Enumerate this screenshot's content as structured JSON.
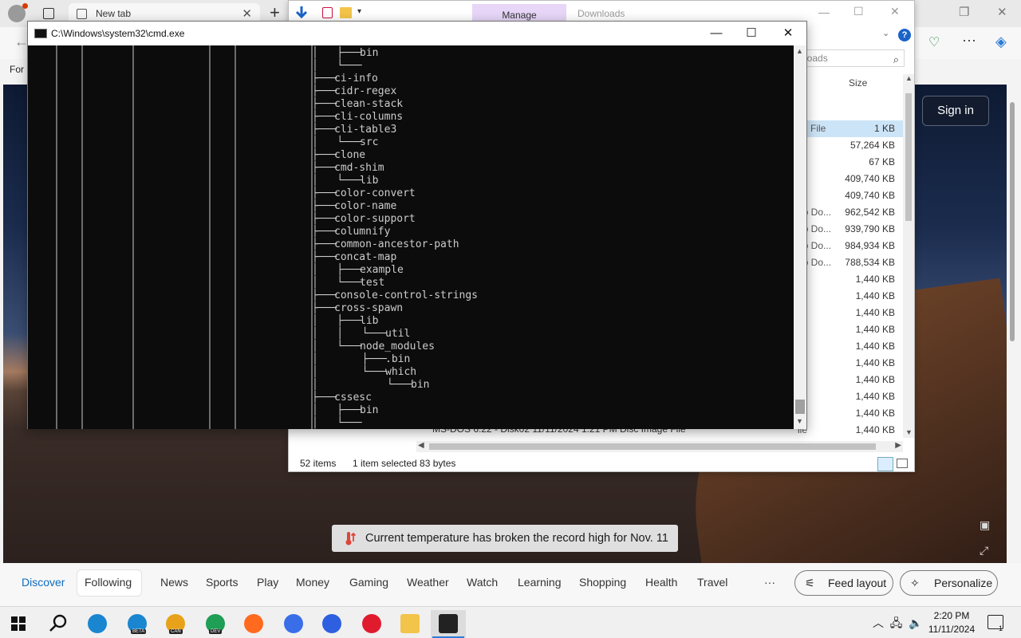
{
  "edge": {
    "tab_title": "New tab",
    "favorites_text": "For",
    "signin_label": "Sign in",
    "temperature_banner": "Current temperature has broken the record high for Nov. 11",
    "feed_tabs": [
      "Discover",
      "Following",
      "News",
      "Sports",
      "Play",
      "Money",
      "Gaming",
      "Weather",
      "Watch",
      "Learning",
      "Shopping",
      "Health",
      "Travel"
    ],
    "more_label": "···",
    "feed_layout_label": "Feed layout",
    "personalize_label": "Personalize"
  },
  "explorer": {
    "manage_label": "Manage",
    "title": "Downloads",
    "search_placeholder": "loads",
    "column_size": "Size",
    "rows": [
      {
        "type": "ch File",
        "size": "1 KB",
        "selected": true
      },
      {
        "type": "",
        "size": "57,264 KB"
      },
      {
        "type": "",
        "size": "67 KB"
      },
      {
        "type": "",
        "size": "409,740 KB"
      },
      {
        "type": "",
        "size": "409,740 KB"
      },
      {
        "type": "eb Do...",
        "size": "962,542 KB"
      },
      {
        "type": "eb Do...",
        "size": "939,790 KB"
      },
      {
        "type": "eb Do...",
        "size": "984,934 KB"
      },
      {
        "type": "eb Do...",
        "size": "788,534 KB"
      },
      {
        "type": "ile",
        "size": "1,440 KB"
      },
      {
        "type": "ile",
        "size": "1,440 KB"
      },
      {
        "type": "ile",
        "size": "1,440 KB"
      },
      {
        "type": "ile",
        "size": "1,440 KB"
      },
      {
        "type": "ile",
        "size": "1,440 KB"
      },
      {
        "type": "ile",
        "size": "1,440 KB"
      },
      {
        "type": "ile",
        "size": "1,440 KB"
      },
      {
        "type": "ile",
        "size": "1,440 KB"
      },
      {
        "type": "ile",
        "size": "1,440 KB"
      },
      {
        "type": "ile",
        "size": "1,440 KB"
      }
    ],
    "hidden_row_text": "MS-DOS 6.22 - Disk02          11/11/2024 1:21 PM          Disc Image File",
    "status_items": "52 items",
    "status_selected": "1 item selected  83 bytes"
  },
  "cmd": {
    "title": "C:\\Windows\\system32\\cmd.exe",
    "tree": [
      {
        "depth": 1,
        "connector": "│   ├───",
        "name": "bin"
      },
      {
        "depth": 1,
        "connector": "│   └───",
        "name": ""
      },
      {
        "depth": 0,
        "connector": "├───",
        "name": "ci-info"
      },
      {
        "depth": 0,
        "connector": "├───",
        "name": "cidr-regex"
      },
      {
        "depth": 0,
        "connector": "├───",
        "name": "clean-stack"
      },
      {
        "depth": 0,
        "connector": "├───",
        "name": "cli-columns"
      },
      {
        "depth": 0,
        "connector": "├───",
        "name": "cli-table3"
      },
      {
        "depth": 1,
        "connector": "│   └───",
        "name": "src"
      },
      {
        "depth": 0,
        "connector": "├───",
        "name": "clone"
      },
      {
        "depth": 0,
        "connector": "├───",
        "name": "cmd-shim"
      },
      {
        "depth": 1,
        "connector": "│   └───",
        "name": "lib"
      },
      {
        "depth": 0,
        "connector": "├───",
        "name": "color-convert"
      },
      {
        "depth": 0,
        "connector": "├───",
        "name": "color-name"
      },
      {
        "depth": 0,
        "connector": "├───",
        "name": "color-support"
      },
      {
        "depth": 0,
        "connector": "├───",
        "name": "columnify"
      },
      {
        "depth": 0,
        "connector": "├───",
        "name": "common-ancestor-path"
      },
      {
        "depth": 0,
        "connector": "├───",
        "name": "concat-map"
      },
      {
        "depth": 1,
        "connector": "│   ├───",
        "name": "example"
      },
      {
        "depth": 1,
        "connector": "│   └───",
        "name": "test"
      },
      {
        "depth": 0,
        "connector": "├───",
        "name": "console-control-strings"
      },
      {
        "depth": 0,
        "connector": "├───",
        "name": "cross-spawn"
      },
      {
        "depth": 1,
        "connector": "│   ├───",
        "name": "lib"
      },
      {
        "depth": 2,
        "connector": "│   │   └───",
        "name": "util"
      },
      {
        "depth": 1,
        "connector": "│   └───",
        "name": "node_modules"
      },
      {
        "depth": 2,
        "connector": "│       ├───",
        "name": ".bin"
      },
      {
        "depth": 2,
        "connector": "│       └───",
        "name": "which"
      },
      {
        "depth": 3,
        "connector": "│           └───",
        "name": "bin"
      },
      {
        "depth": 0,
        "connector": "├───",
        "name": "cssesc"
      },
      {
        "depth": 1,
        "connector": "│   ├───",
        "name": "bin"
      },
      {
        "depth": 1,
        "connector": "│   └───",
        "name": ""
      }
    ]
  },
  "taskbar": {
    "apps": [
      {
        "name": "edge",
        "color": "#1a86d0",
        "badge": ""
      },
      {
        "name": "edge-beta",
        "color": "#1a86d0",
        "badge": "BETA"
      },
      {
        "name": "edge-canary",
        "color": "#e8a21a",
        "badge": "CAN"
      },
      {
        "name": "edge-dev",
        "color": "#1f9e55",
        "badge": "DEV"
      },
      {
        "name": "firefox",
        "color": "#ff6a1f",
        "badge": ""
      },
      {
        "name": "firefox-dev",
        "color": "#3a6ee8",
        "badge": ""
      },
      {
        "name": "firefox-nightly",
        "color": "#2d5fe0",
        "badge": ""
      },
      {
        "name": "opera",
        "color": "#e01b2e",
        "badge": ""
      },
      {
        "name": "file-explorer",
        "color": "#f3c44a",
        "badge": ""
      },
      {
        "name": "cmd",
        "color": "#222222",
        "badge": ""
      }
    ],
    "time": "2:20 PM",
    "date": "11/11/2024",
    "notification_count": "1"
  }
}
